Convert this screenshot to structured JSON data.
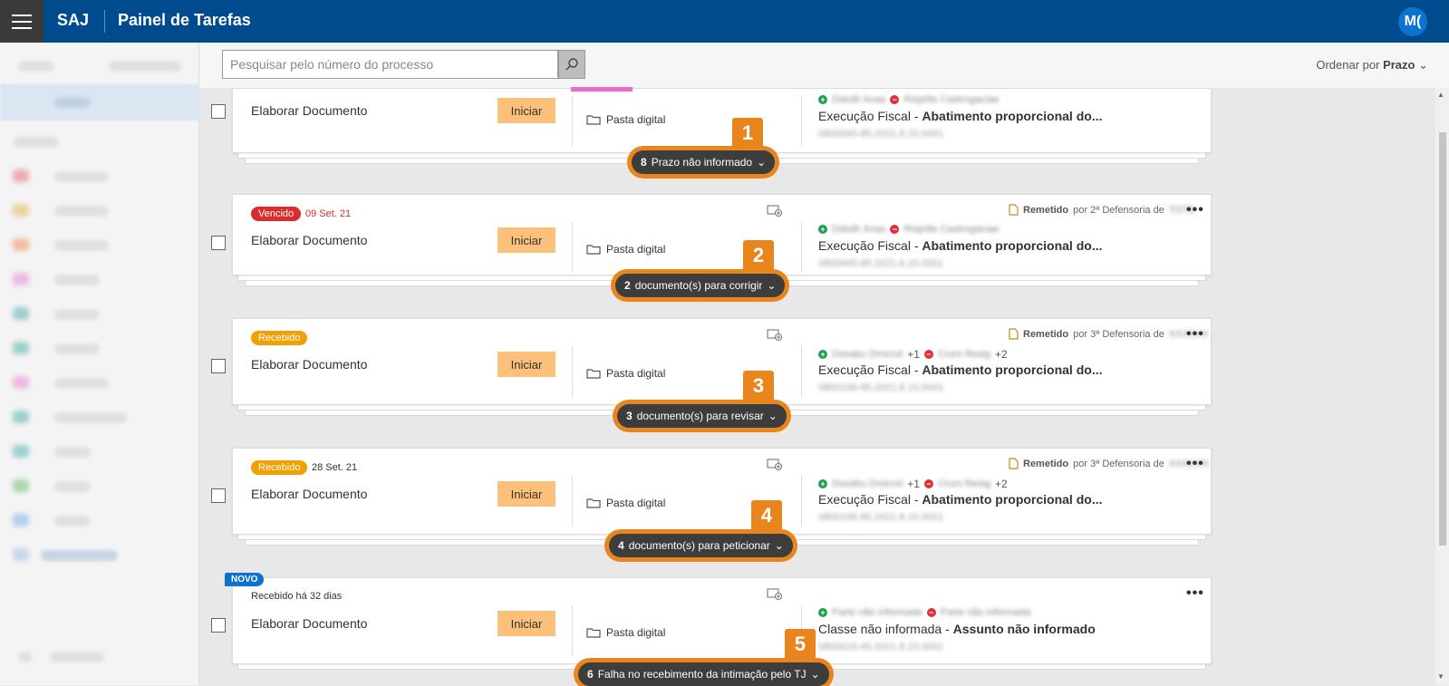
{
  "header": {
    "brand": "SAJ",
    "title": "Painel de Tarefas",
    "avatar_initials": "M("
  },
  "search": {
    "placeholder": "Pesquisar pelo número do processo"
  },
  "order": {
    "label": "Ordenar por",
    "value": "Prazo"
  },
  "common": {
    "task_title": "Elaborar Documento",
    "start_label": "Iniciar",
    "folder_label": "Pasta digital",
    "remetido_label": "Remetido"
  },
  "cards": [
    {
      "classe": "Execução Fiscal - ",
      "assunto": "Abatimento proporcional do...",
      "pill_count": "8",
      "pill_text": "Prazo não informado",
      "marker": "1"
    },
    {
      "status": "Vencido",
      "date": "09 Set. 21",
      "remetido_by": "por 2ª Defensoria de",
      "classe": "Execução Fiscal - ",
      "assunto": "Abatimento proporcional do...",
      "pill_count": "2",
      "pill_text": "documento(s) para corrigir",
      "marker": "2"
    },
    {
      "status": "Recebido",
      "remetido_by": "por 3ª Defensoria de",
      "plus_a": "+1",
      "plus_b": "+2",
      "classe": "Execução Fiscal - ",
      "assunto": "Abatimento proporcional do...",
      "pill_count": "3",
      "pill_text": "documento(s) para revisar",
      "marker": "3"
    },
    {
      "status": "Recebido",
      "date": "28 Set. 21",
      "remetido_by": "por 3ª Defensoria de",
      "plus_a": "+1",
      "plus_b": "+2",
      "classe": "Execução Fiscal - ",
      "assunto": "Abatimento proporcional do...",
      "pill_count": "4",
      "pill_text": "documento(s) para peticionar",
      "marker": "4"
    },
    {
      "new_badge": "NOVO",
      "received_text": "Recebido há 32 dias",
      "classe": "Classe não informada - ",
      "assunto": "Assunto não informado",
      "pill_count": "6",
      "pill_text": "Falha no recebimento da intimação pelo TJ",
      "marker": "5"
    }
  ]
}
